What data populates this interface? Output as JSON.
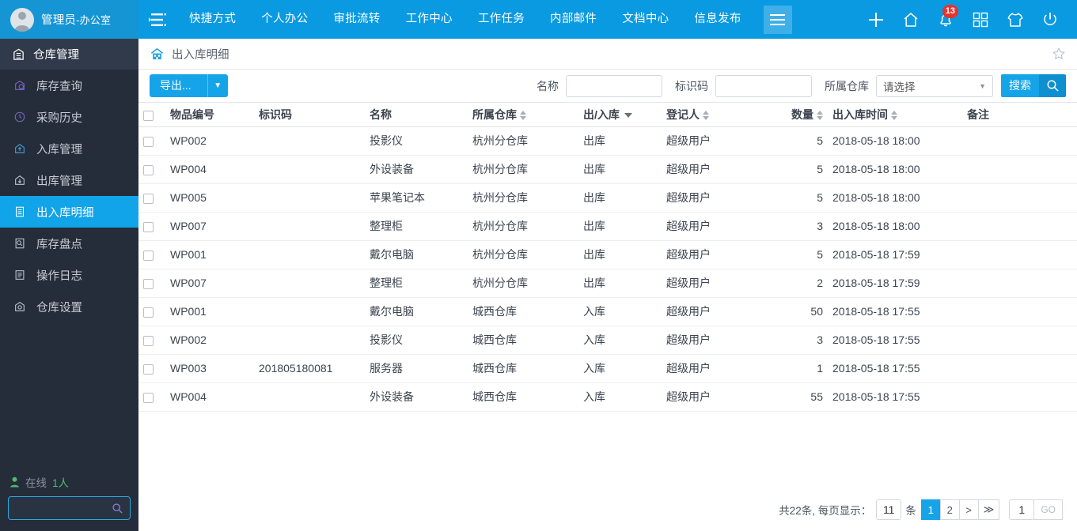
{
  "topbar": {
    "user": "管理员",
    "department": "-办公室",
    "avatar_icon": "user-avatar-icon",
    "nav_toggle_icon": "collapse-nav-icon",
    "nav_items": [
      {
        "label": "快捷方式"
      },
      {
        "label": "个人办公"
      },
      {
        "label": "审批流转"
      },
      {
        "label": "工作中心"
      },
      {
        "label": "工作任务"
      },
      {
        "label": "内部邮件"
      },
      {
        "label": "文档中心"
      },
      {
        "label": "信息发布"
      }
    ],
    "hamburger_icon": "hamburger-menu-icon",
    "icons": [
      {
        "name": "plus-icon"
      },
      {
        "name": "home-icon"
      },
      {
        "name": "bell-icon",
        "badge": "13"
      },
      {
        "name": "apps-grid-icon"
      },
      {
        "name": "shirt-theme-icon"
      },
      {
        "name": "power-icon"
      }
    ],
    "badge_color": "#e8322d",
    "bg_color": "#0a9ae1"
  },
  "sidebar": {
    "header": {
      "label": "仓库管理",
      "icon": "warehouse-icon"
    },
    "items": [
      {
        "label": "库存查询",
        "icon": "inventory-search-icon",
        "active": false
      },
      {
        "label": "采购历史",
        "icon": "clock-history-icon",
        "active": false
      },
      {
        "label": "入库管理",
        "icon": "inbound-icon",
        "active": false
      },
      {
        "label": "出库管理",
        "icon": "outbound-icon",
        "active": false
      },
      {
        "label": "出入库明细",
        "icon": "detail-list-icon",
        "active": true
      },
      {
        "label": "库存盘点",
        "icon": "stocktake-icon",
        "active": false
      },
      {
        "label": "操作日志",
        "icon": "operation-log-icon",
        "active": false
      },
      {
        "label": "仓库设置",
        "icon": "warehouse-settings-icon",
        "active": false
      }
    ],
    "online": {
      "icon": "person-icon",
      "label": "在线",
      "count": "1人"
    },
    "search": {
      "value": "",
      "placeholder": "",
      "icon": "search-icon"
    },
    "active_color": "#12a4e8"
  },
  "breadcrumb": {
    "icon": "home-breadcrumb-icon",
    "title": "出入库明细",
    "star_icon": "favorite-star-icon"
  },
  "toolbar": {
    "export_label": "导出...",
    "export_caret_icon": "chevron-down-icon",
    "name_label": "名称",
    "name_value": "",
    "code_label": "标识码",
    "code_value": "",
    "warehouse_label": "所属仓库",
    "warehouse_selected": "请选择",
    "warehouse_caret_icon": "chevron-down-icon",
    "search_label": "搜索",
    "search_icon": "search-icon"
  },
  "table": {
    "columns": [
      {
        "key": "checkbox",
        "label": "",
        "sort": "none"
      },
      {
        "key": "item_no",
        "label": "物品编号",
        "sort": "none"
      },
      {
        "key": "code",
        "label": "标识码",
        "sort": "none"
      },
      {
        "key": "name",
        "label": "名称",
        "sort": "none"
      },
      {
        "key": "warehouse",
        "label": "所属仓库",
        "sort": "both"
      },
      {
        "key": "io",
        "label": "出/入库",
        "sort": "filter"
      },
      {
        "key": "registrant",
        "label": "登记人",
        "sort": "both"
      },
      {
        "key": "qty",
        "label": "数量",
        "sort": "both"
      },
      {
        "key": "time",
        "label": "出入库时间",
        "sort": "both"
      },
      {
        "key": "note",
        "label": "备注",
        "sort": "none"
      }
    ],
    "rows": [
      {
        "item_no": "WP002",
        "code": "",
        "name": "投影仪",
        "warehouse": "杭州分仓库",
        "io": "出库",
        "registrant": "超级用户",
        "qty": "5",
        "time": "2018-05-18 18:00",
        "note": ""
      },
      {
        "item_no": "WP004",
        "code": "",
        "name": "外设装备",
        "warehouse": "杭州分仓库",
        "io": "出库",
        "registrant": "超级用户",
        "qty": "5",
        "time": "2018-05-18 18:00",
        "note": ""
      },
      {
        "item_no": "WP005",
        "code": "",
        "name": "苹果笔记本",
        "warehouse": "杭州分仓库",
        "io": "出库",
        "registrant": "超级用户",
        "qty": "5",
        "time": "2018-05-18 18:00",
        "note": ""
      },
      {
        "item_no": "WP007",
        "code": "",
        "name": "整理柜",
        "warehouse": "杭州分仓库",
        "io": "出库",
        "registrant": "超级用户",
        "qty": "3",
        "time": "2018-05-18 18:00",
        "note": ""
      },
      {
        "item_no": "WP001",
        "code": "",
        "name": "戴尔电脑",
        "warehouse": "杭州分仓库",
        "io": "出库",
        "registrant": "超级用户",
        "qty": "5",
        "time": "2018-05-18 17:59",
        "note": ""
      },
      {
        "item_no": "WP007",
        "code": "",
        "name": "整理柜",
        "warehouse": "杭州分仓库",
        "io": "出库",
        "registrant": "超级用户",
        "qty": "2",
        "time": "2018-05-18 17:59",
        "note": ""
      },
      {
        "item_no": "WP001",
        "code": "",
        "name": "戴尔电脑",
        "warehouse": "城西仓库",
        "io": "入库",
        "registrant": "超级用户",
        "qty": "50",
        "time": "2018-05-18 17:55",
        "note": ""
      },
      {
        "item_no": "WP002",
        "code": "",
        "name": "投影仪",
        "warehouse": "城西仓库",
        "io": "入库",
        "registrant": "超级用户",
        "qty": "3",
        "time": "2018-05-18 17:55",
        "note": ""
      },
      {
        "item_no": "WP003",
        "code": "201805180081",
        "name": "服务器",
        "warehouse": "城西仓库",
        "io": "入库",
        "registrant": "超级用户",
        "qty": "1",
        "time": "2018-05-18 17:55",
        "note": ""
      },
      {
        "item_no": "WP004",
        "code": "",
        "name": "外设装备",
        "warehouse": "城西仓库",
        "io": "入库",
        "registrant": "超级用户",
        "qty": "55",
        "time": "2018-05-18 17:55",
        "note": ""
      }
    ]
  },
  "pagination": {
    "summary": "共22条, 每页显示：",
    "page_size": "11",
    "unit": "条",
    "pages": [
      {
        "label": "1",
        "active": true
      },
      {
        "label": "2",
        "active": false
      },
      {
        "label": ">",
        "active": false
      },
      {
        "label": "≫",
        "active": false
      }
    ],
    "jump_value": "1",
    "go_label": "GO"
  }
}
